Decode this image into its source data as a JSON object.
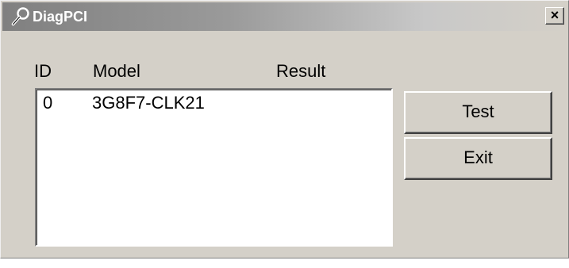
{
  "window": {
    "title": "DiagPCI",
    "close_label": "×"
  },
  "columns": {
    "id": "ID",
    "model": "Model",
    "result": "Result"
  },
  "rows": [
    {
      "id": "0",
      "model": "3G8F7-CLK21",
      "result": ""
    }
  ],
  "buttons": {
    "test": "Test",
    "exit": "Exit"
  },
  "icons": {
    "title": "wrench-icon",
    "close": "close-icon"
  },
  "colors": {
    "face": "#d4d0c8",
    "titlebar_start": "#808080",
    "titlebar_end": "#d4d0c8",
    "list_bg": "#ffffff"
  }
}
